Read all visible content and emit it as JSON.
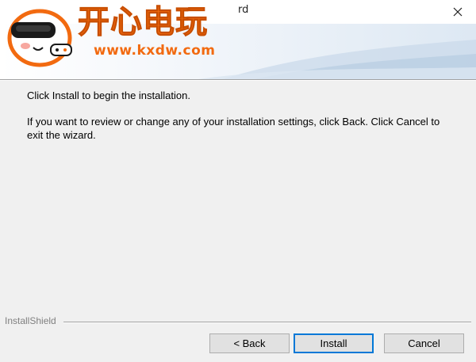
{
  "window": {
    "title_fragment": "rd",
    "close_label": "Close"
  },
  "watermark": {
    "chinese_text": "开心电玩",
    "url": "www.kxdw.com",
    "colors": {
      "orange": "#f26a10",
      "mascot_headset": "#1a1a1a"
    }
  },
  "content": {
    "line1": "Click Install to begin the installation.",
    "line2": "If you want to review or change any of your installation settings, click Back. Click Cancel to exit the wizard."
  },
  "footer": {
    "brand": "InstallShield"
  },
  "buttons": {
    "back": "< Back",
    "install": "Install",
    "cancel": "Cancel"
  },
  "colors": {
    "default_button_border": "#0078d7",
    "dialog_background": "#f0f0f0"
  }
}
